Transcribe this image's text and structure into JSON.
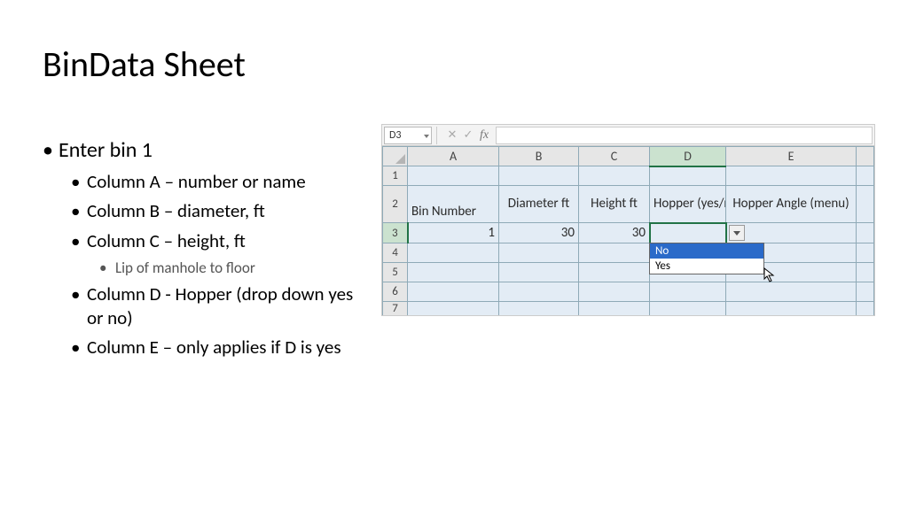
{
  "slide": {
    "title": "BinData Sheet",
    "bullets": {
      "b1": "Enter bin 1",
      "b2a": "Column A – number or name",
      "b2b": "Column B – diameter, ft",
      "b2c": "Column C – height, ft",
      "b3a": "Lip of manhole to floor",
      "b2d": "Column D - Hopper (drop down yes or no)",
      "b2e": "Column E – only applies if D is yes"
    }
  },
  "excel": {
    "namebox": "D3",
    "cols": {
      "A": "A",
      "B": "B",
      "C": "C",
      "D": "D",
      "E": "E"
    },
    "rows": {
      "r1": "1",
      "r2": "2",
      "r3": "3",
      "r4": "4",
      "r5": "5",
      "r6": "6",
      "r7": "7"
    },
    "headers": {
      "A": "Bin Number",
      "B": "Diameter ft",
      "C": "Height ft",
      "D": "Hopper (yes/no)",
      "E": "Hopper Angle (menu)"
    },
    "row3": {
      "A": "1",
      "B": "30",
      "C": "30",
      "D": "",
      "E": ""
    },
    "dropdown": {
      "opt1": "No",
      "opt2": "Yes"
    }
  }
}
